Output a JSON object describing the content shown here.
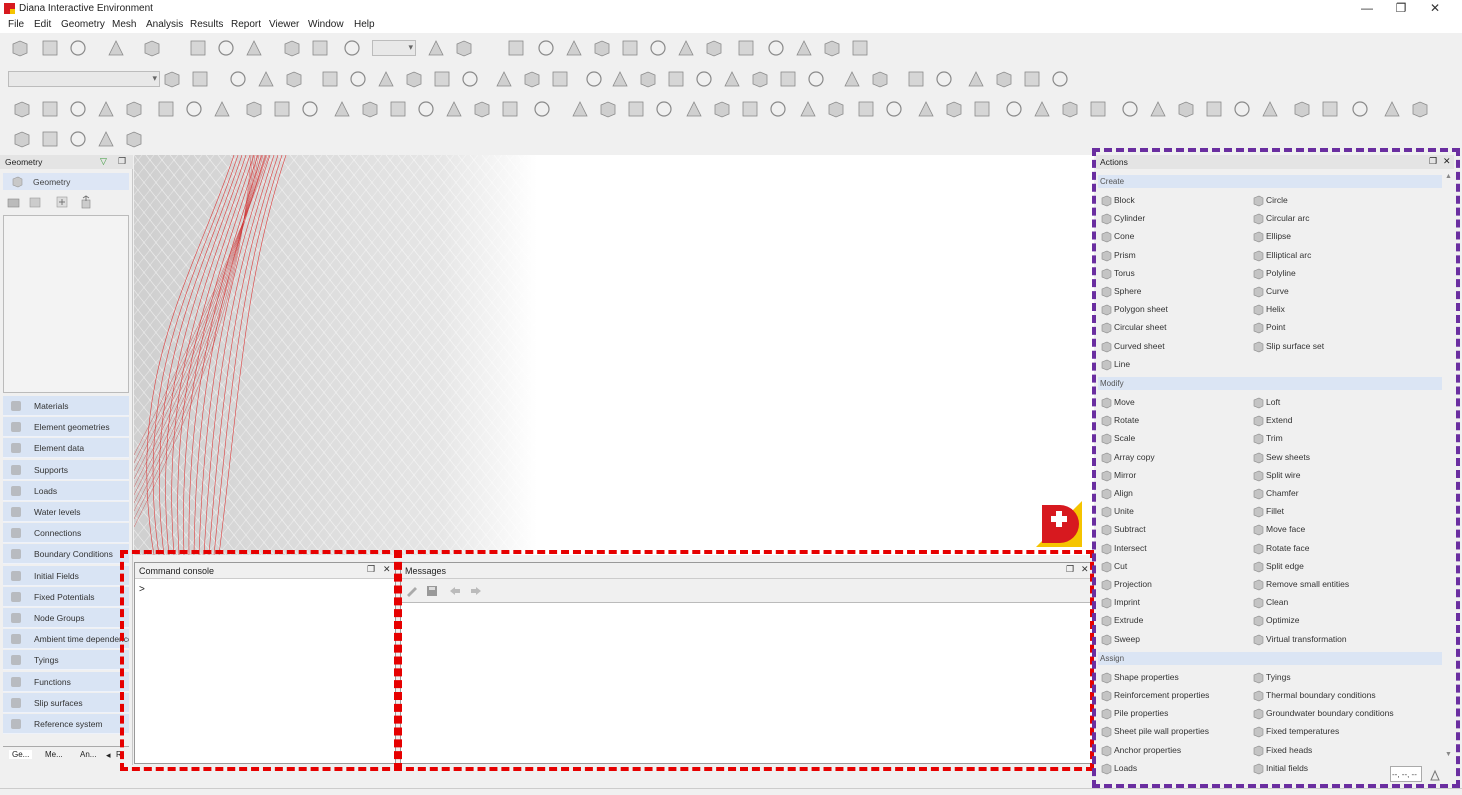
{
  "window": {
    "title": "Diana Interactive Environment",
    "minimize": "—",
    "restore": "❐",
    "close": "✕"
  },
  "menu": [
    "File",
    "Edit",
    "Geometry",
    "Mesh",
    "Analysis",
    "Results",
    "Report",
    "Viewer",
    "Window",
    "Help"
  ],
  "left_panel": {
    "title": "Geometry",
    "geometry_item": "Geometry",
    "items": [
      "Materials",
      "Element geometries",
      "Element data",
      "Supports",
      "Loads",
      "Water levels",
      "Connections",
      "Boundary Conditions",
      "Initial Fields",
      "Fixed Potentials",
      "Node Groups",
      "Ambient time dependence",
      "Tyings",
      "Functions",
      "Slip surfaces",
      "Reference system"
    ],
    "tabs": [
      "Ge...",
      "Me...",
      "An...",
      "R"
    ]
  },
  "console": {
    "title": "Command console",
    "prompt": ">"
  },
  "messages": {
    "title": "Messages"
  },
  "actions": {
    "title": "Actions",
    "sections": [
      {
        "name": "Create",
        "left": [
          "Block",
          "Cylinder",
          "Cone",
          "Prism",
          "Torus",
          "Sphere",
          "Polygon sheet",
          "Circular sheet",
          "Curved sheet",
          "Line"
        ],
        "right": [
          "Circle",
          "Circular arc",
          "Ellipse",
          "Elliptical arc",
          "Polyline",
          "Curve",
          "Helix",
          "Point",
          "Slip surface set"
        ]
      },
      {
        "name": "Modify",
        "left": [
          "Move",
          "Rotate",
          "Scale",
          "Array copy",
          "Mirror",
          "Align",
          "Unite",
          "Subtract",
          "Intersect",
          "Cut",
          "Projection",
          "Imprint",
          "Extrude",
          "Sweep"
        ],
        "right": [
          "Loft",
          "Extend",
          "Trim",
          "Sew sheets",
          "Split wire",
          "Chamfer",
          "Fillet",
          "Move face",
          "Rotate face",
          "Split edge",
          "Remove small entities",
          "Clean",
          "Optimize",
          "Virtual transformation"
        ]
      },
      {
        "name": "Assign",
        "left": [
          "Shape properties",
          "Reinforcement properties",
          "Pile properties",
          "Sheet pile wall properties",
          "Anchor properties",
          "Loads"
        ],
        "right": [
          "Tyings",
          "Thermal boundary conditions",
          "Groundwater boundary conditions",
          "Fixed temperatures",
          "Fixed heads",
          "Initial fields"
        ]
      }
    ]
  },
  "coords": "--, --, --",
  "colors": {
    "accent_red": "#e60000",
    "accent_purple": "#6a2ea0",
    "logo_red": "#d7191f",
    "logo_yellow": "#f5c400",
    "section_bg": "#dbe5f4"
  }
}
